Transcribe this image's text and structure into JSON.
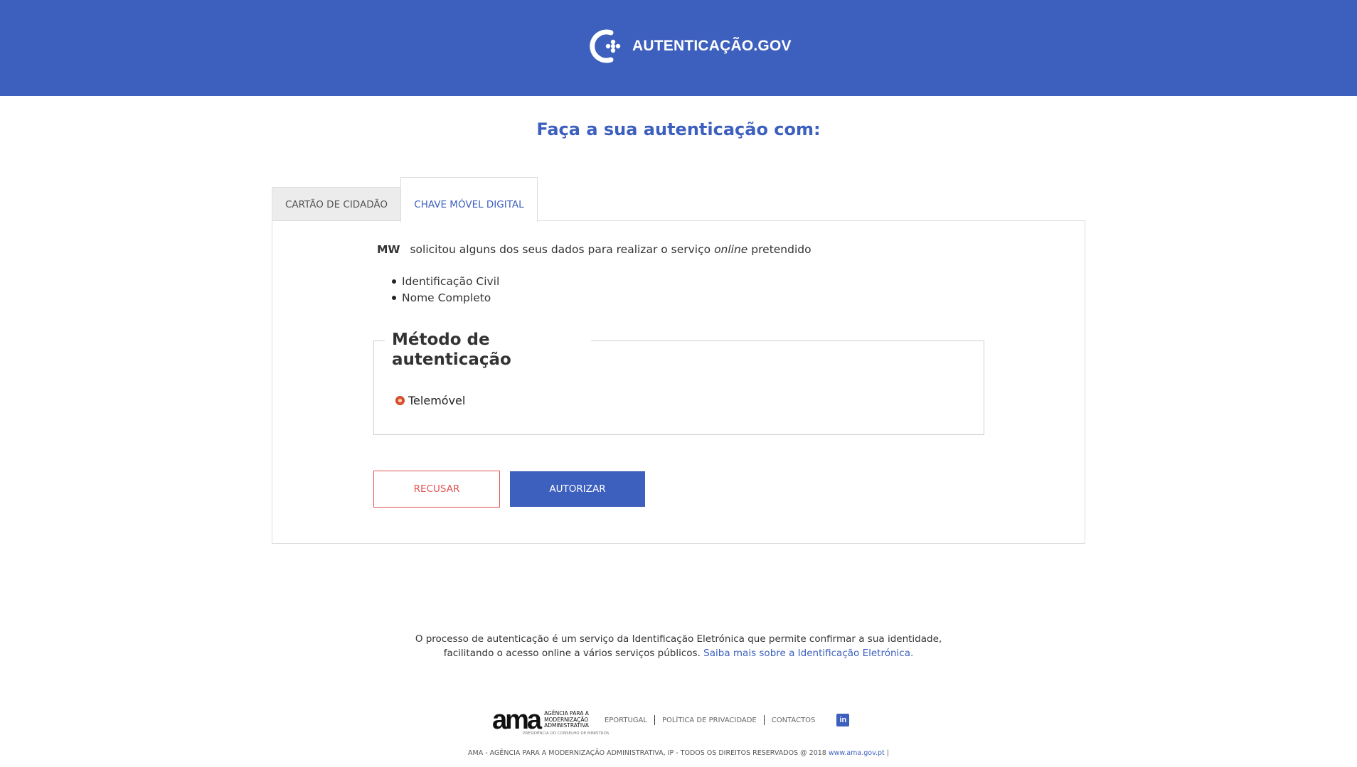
{
  "header": {
    "brand_name": "AUTENTICAÇÃO.GOV",
    "logo_icon": "autenticacao-gov-logo",
    "background_color": "#3d5fbe"
  },
  "main": {
    "title": "Faça a sua autenticação com:",
    "tabs": [
      {
        "label": "CARTÃO DE CIDADÃO",
        "active": false
      },
      {
        "label": "CHAVE MÓVEL DIGITAL",
        "active": true
      }
    ],
    "request": {
      "service_name": "MW",
      "text_before": "solicitou alguns dos seus dados para realizar o serviço",
      "text_italic": "online",
      "text_after": "pretendido"
    },
    "requested_data": [
      "Identificação Civil",
      "Nome Completo"
    ],
    "auth_method": {
      "legend_line1": "Método de",
      "legend_line2": "autenticação",
      "options": [
        {
          "label": "Telemóvel",
          "selected": true
        }
      ]
    },
    "buttons": {
      "refuse_label": "RECUSAR",
      "authorize_label": "AUTORIZAR"
    }
  },
  "info": {
    "line1": "O processo de autenticação é um serviço da Identificação Eletrónica que permite confirmar a sua identidade,",
    "line2": "facilitando o acesso online a vários serviços públicos.",
    "link": "Saiba mais sobre a Identificação Eletrónica."
  },
  "footer": {
    "ama_mark": "ama",
    "ama_text_1": "AGÊNCIA PARA A",
    "ama_text_2": "MODERNIZAÇÃO",
    "ama_text_3": "ADMINISTRATIVA",
    "ama_subtext": "PRESIDÊNCIA DO CONSELHO DE MINISTROS",
    "links": [
      "EPORTUGAL",
      "POLÍTICA DE PRIVACIDADE",
      "CONTACTOS"
    ],
    "social_icon": "linkedin-icon",
    "social_label": "in",
    "copyright": "AMA - AGÊNCIA PARA A MODERNIZAÇÃO ADMINISTRATIVA, IP - TODOS OS DIREITOS RESERVADOS @ 2018",
    "site": "www.ama.gov.pt",
    "trailing": "|"
  },
  "colors": {
    "primary": "#3d5fbe",
    "refuse": "#e05555",
    "radio": "#e0542d"
  }
}
